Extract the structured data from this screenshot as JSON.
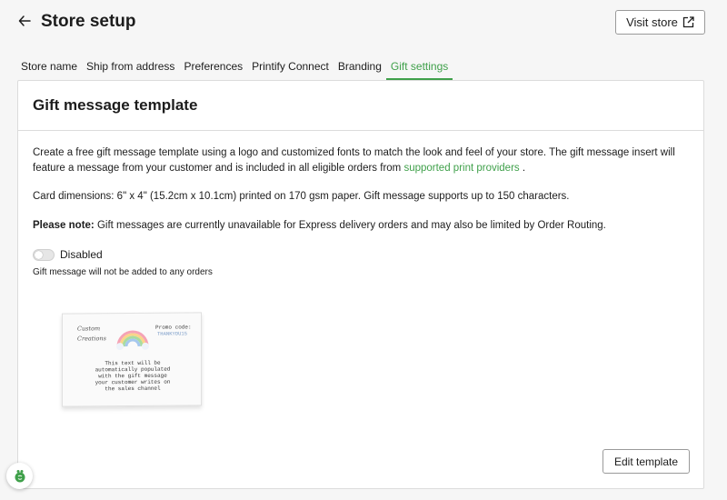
{
  "header": {
    "title": "Store setup",
    "back_icon": "arrow-left-icon",
    "visit_store_label": "Visit store",
    "visit_store_icon": "external-link-icon"
  },
  "tabs": [
    {
      "label": "Store name",
      "active": false
    },
    {
      "label": "Ship from address",
      "active": false
    },
    {
      "label": "Preferences",
      "active": false
    },
    {
      "label": "Printify Connect",
      "active": false
    },
    {
      "label": "Branding",
      "active": false
    },
    {
      "label": "Gift settings",
      "active": true
    }
  ],
  "card": {
    "title": "Gift message template",
    "description_1": "Create a free gift message template using a logo and customized fonts to match the look and feel of your store. The gift message insert will feature a message from your customer and is included in all eligible orders from",
    "description_link": "supported print providers",
    "description_end": ".",
    "dimensions": "Card dimensions: 6\" x 4\" (15.2cm x 10.1cm) printed on 170 gsm paper. Gift message supports up to 150 characters.",
    "note_bold": "Please note:",
    "note_text": " Gift messages are currently unavailable for Express delivery orders and may also be limited by Order Routing.",
    "toggle_label": "Disabled",
    "toggle_on": false,
    "toggle_help": "Gift message will not be added to any orders",
    "edit_template_label": "Edit template"
  },
  "preview": {
    "logo_line1": "Custom",
    "logo_line2": "Creations",
    "promo_label": "Promo code:",
    "promo_code": "THANKYOU15",
    "message_lines": [
      "This text will be",
      "automatically populated",
      "with the gift message",
      "your customer writes on",
      "the sales channel"
    ]
  },
  "colors": {
    "accent": "#3fa04a",
    "border": "#dcdcdc",
    "background": "#f6f6f6"
  },
  "help_button_icon": "printify-help-icon"
}
